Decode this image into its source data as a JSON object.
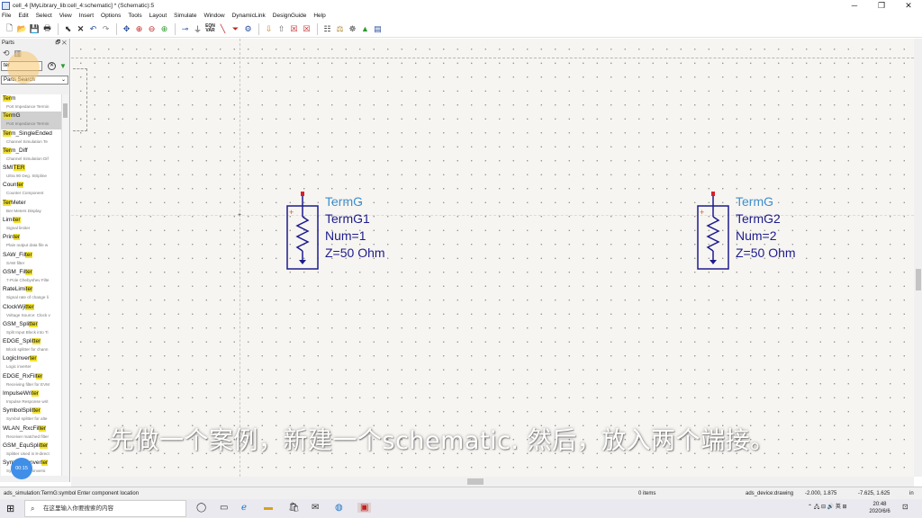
{
  "window": {
    "title": "cell_4 [MyLibrary_lib:cell_4:schematic] * (Schematic):5",
    "controls": [
      "─",
      "❐",
      "✕"
    ]
  },
  "menu": [
    "File",
    "Edit",
    "Select",
    "View",
    "Insert",
    "Options",
    "Tools",
    "Layout",
    "Simulate",
    "Window",
    "DynamicLink",
    "DesignGuide",
    "Help"
  ],
  "toolbar": {
    "var_label": "VAR",
    "var_sub": "EQN"
  },
  "parts_panel": {
    "header": "Parts",
    "header_controls": "🗗 ✕",
    "search_value": "ter",
    "source_select": "Parts Search",
    "items": [
      {
        "pre": "",
        "hl": "Ter",
        "post": "m",
        "desc": "Port Impedance Termin"
      },
      {
        "pre": "",
        "hl": "Ter",
        "post": "mG",
        "desc": "Port Impedance Termin"
      },
      {
        "pre": "",
        "hl": "Ter",
        "post": "m_SingleEnded",
        "desc": "Channel Simulation Te"
      },
      {
        "pre": "",
        "hl": "Ter",
        "post": "m_Diff",
        "desc": "Channel Simulation Dif"
      },
      {
        "pre": "SMI",
        "hl": "TER",
        "post": "",
        "desc": "Ultra 90 Deg. Stripline"
      },
      {
        "pre": "Coun",
        "hl": "ter",
        "post": "",
        "desc": "Counter Component"
      },
      {
        "pre": "",
        "hl": "Ter",
        "post": "Meter",
        "desc": "Ber Meters Display"
      },
      {
        "pre": "Limi",
        "hl": "ter",
        "post": "",
        "desc": "Signal limiter"
      },
      {
        "pre": "Prin",
        "hl": "ter",
        "post": "",
        "desc": "Plain output data file w"
      },
      {
        "pre": "SAW_Fil",
        "hl": "ter",
        "post": "",
        "desc": "SAW filter"
      },
      {
        "pre": "GSM_Fil",
        "hl": "ter",
        "post": "",
        "desc": "7-Pole Chebyshev Filte"
      },
      {
        "pre": "RateLimi",
        "hl": "ter",
        "post": "",
        "desc": "Signal rate of change li"
      },
      {
        "pre": "ClockWji",
        "hl": "tter",
        "post": "",
        "desc": "Voltage Source: Clock v"
      },
      {
        "pre": "GSM_Spli",
        "hl": "tter",
        "post": "",
        "desc": "Split Input Block into Ti"
      },
      {
        "pre": "EDGE_Spli",
        "hl": "tter",
        "post": "",
        "desc": "Block splitter for chann"
      },
      {
        "pre": "LogicInver",
        "hl": "ter",
        "post": "",
        "desc": "Logic inverter"
      },
      {
        "pre": "EDGE_RxFil",
        "hl": "ter",
        "post": "",
        "desc": "Receiving filter for EVM"
      },
      {
        "pre": "ImpulseWri",
        "hl": "ter",
        "post": "",
        "desc": "Impulse Response writ"
      },
      {
        "pre": "SymbolSpli",
        "hl": "tter",
        "post": "",
        "desc": "Symbol splitter for alte"
      },
      {
        "pre": "WLAN_RxcFil",
        "hl": "ter",
        "post": "",
        "desc": "Receiver matched filter"
      },
      {
        "pre": "GSM_EquSpli",
        "hl": "tter",
        "post": "",
        "desc": "Splitter Used in 8-direct"
      },
      {
        "pre": "SymbolConver",
        "hl": "ter",
        "post": "",
        "desc": "Symbol cost conversi"
      }
    ],
    "timer": "00:15"
  },
  "components": [
    {
      "name": "TermG",
      "inst": "TermG1",
      "num": "Num=1",
      "z": "Z=50 Ohm"
    },
    {
      "name": "TermG",
      "inst": "TermG2",
      "num": "Num=2",
      "z": "Z=50 Ohm"
    }
  ],
  "subtitle": "先做一个案例，新建一个schematic. 然后，放入两个端接。",
  "statusbar": {
    "message": "ads_simulation:TermG:symbol  Enter component location",
    "items": "0 items",
    "layer": "ads_device:drawing",
    "coord1": "-2.000, 1.875",
    "coord2": "-7.625, 1.625",
    "unit": "in"
  },
  "taskbar": {
    "search_placeholder": "在这里输入你要搜索的内容",
    "tray": "⌃ 🖧 ⊟ 🔊 英 ⊞",
    "time": "20:48",
    "date": "2020/6/6",
    "notif": "⊡"
  }
}
